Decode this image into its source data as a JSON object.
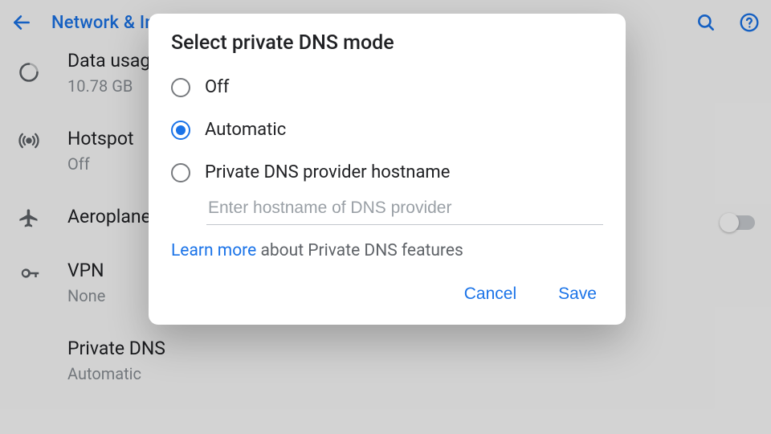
{
  "appbar": {
    "title": "Network & Internet"
  },
  "settings": {
    "data_usage": {
      "title": "Data usage",
      "subtitle": "10.78 GB"
    },
    "hotspot": {
      "title": "Hotspot",
      "subtitle": "Off"
    },
    "aeroplane": {
      "title": "Aeroplane mode"
    },
    "vpn": {
      "title": "VPN",
      "subtitle": "None"
    },
    "pdns": {
      "title": "Private DNS",
      "subtitle": "Automatic"
    }
  },
  "dialog": {
    "title": "Select private DNS mode",
    "options": {
      "off": "Off",
      "auto": "Automatic",
      "hostname": "Private DNS provider hostname"
    },
    "selected": "auto",
    "hostname_placeholder": "Enter hostname of DNS provider",
    "hostname_value": "",
    "learn_link": "Learn more",
    "learn_rest": " about Private DNS features",
    "cancel": "Cancel",
    "save": "Save"
  }
}
